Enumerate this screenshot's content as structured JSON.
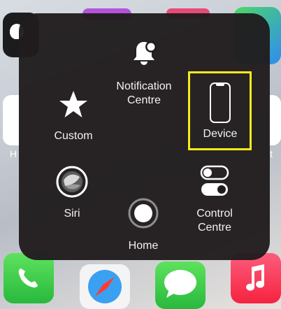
{
  "menu": {
    "notification": {
      "label": "Notification\nCentre"
    },
    "custom": {
      "label": "Custom"
    },
    "device": {
      "label": "Device"
    },
    "siri": {
      "label": "Siri"
    },
    "home": {
      "label": "Home"
    },
    "control": {
      "label": "Control\nCentre"
    }
  },
  "highlight_color": "#f7ea1d",
  "background_labels": {
    "left": "H",
    "right": "t"
  }
}
